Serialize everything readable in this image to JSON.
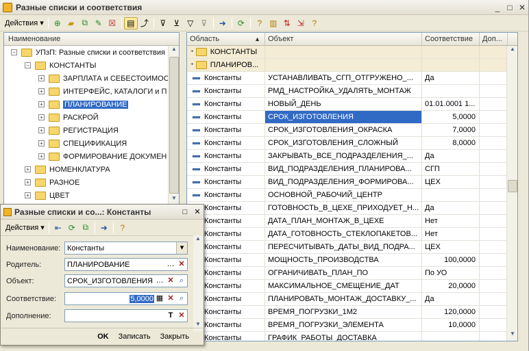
{
  "window": {
    "title": "Разные списки и соответствия",
    "controls": [
      "_",
      "□",
      "✕"
    ]
  },
  "toolbar": {
    "actions_label": "Действия"
  },
  "tree": {
    "header": "Наименование",
    "items": [
      {
        "label": "УПзП: Разные списки и соответствия",
        "level": 0,
        "expander": "−"
      },
      {
        "label": "КОНСТАНТЫ",
        "level": 1,
        "expander": "−"
      },
      {
        "label": "ЗАРПЛАТА и СЕБЕСТОИМОСТЬ",
        "level": 2,
        "expander": "+"
      },
      {
        "label": "ИНТЕРФЕЙС, КАТАЛОГИ и П",
        "level": 2,
        "expander": "+"
      },
      {
        "label": "ПЛАНИРОВАНИЕ",
        "level": 2,
        "expander": "+",
        "selected": true
      },
      {
        "label": "РАСКРОЙ",
        "level": 2,
        "expander": "+"
      },
      {
        "label": "РЕГИСТРАЦИЯ",
        "level": 2,
        "expander": "+"
      },
      {
        "label": "СПЕЦИФИКАЦИЯ",
        "level": 2,
        "expander": "+"
      },
      {
        "label": "ФОРМИРОВАНИЕ ДОКУМЕН",
        "level": 2,
        "expander": "+"
      },
      {
        "label": "НОМЕНКЛАТУРА",
        "level": 1,
        "expander": "+"
      },
      {
        "label": "РАЗНОЕ",
        "level": 1,
        "expander": "+"
      },
      {
        "label": "ЦВЕТ",
        "level": 1,
        "expander": "+"
      }
    ]
  },
  "grid": {
    "headers": [
      "Область",
      "Объект",
      "Соответствие",
      "Доп..."
    ],
    "rows": [
      {
        "area": "КОНСТАНТЫ",
        "object": "",
        "match": "",
        "kind": "folder"
      },
      {
        "area": "ПЛАНИРОВ...",
        "object": "",
        "match": "",
        "kind": "folder"
      },
      {
        "area": "Константы",
        "object": "УСТАНАВЛИВАТЬ_СГП_ОТГРУЖЕНО_...",
        "match": "Да"
      },
      {
        "area": "Константы",
        "object": "РМД_НАСТРОЙКА_УДАЛЯТЬ_МОНТАЖ",
        "match": ""
      },
      {
        "area": "Константы",
        "object": "НОВЫЙ_ДЕНЬ",
        "match": "01.01.0001 1..."
      },
      {
        "area": "Константы",
        "object": "СРОК_ИЗГОТОВЛЕНИЯ",
        "match": "5,0000",
        "numeric": true,
        "selected": true
      },
      {
        "area": "Константы",
        "object": "СРОК_ИЗГОТОВЛЕНИЯ_ОКРАСКА",
        "match": "7,0000",
        "numeric": true
      },
      {
        "area": "Константы",
        "object": "СРОК_ИЗГОТОВЛЕНИЯ_СЛОЖНЫЙ",
        "match": "8,0000",
        "numeric": true
      },
      {
        "area": "Константы",
        "object": "ЗАКРЫВАТЬ_ВСЕ_ПОДРАЗДЕЛЕНИЯ_...",
        "match": "Да"
      },
      {
        "area": "Константы",
        "object": "ВИД_ПОДРАЗДЕЛЕНИЯ_ПЛАНИРОВА...",
        "match": "СГП"
      },
      {
        "area": "Константы",
        "object": "ВИД_ПОДРАЗДЕЛЕНИЯ_ФОРМИРОВА...",
        "match": "ЦЕХ"
      },
      {
        "area": "Константы",
        "object": "ОСНОВНОЙ_РАБОЧИЙ_ЦЕНТР",
        "match": ""
      },
      {
        "area": "Константы",
        "object": "ГОТОВНОСТЬ_В_ЦЕХЕ_ПРИХОДУЕТ_Н...",
        "match": "Да"
      },
      {
        "area": "Константы",
        "object": "ДАТА_ПЛАН_МОНТАЖ_В_ЦЕХЕ",
        "match": "Нет"
      },
      {
        "area": "Константы",
        "object": "ДАТА_ГОТОВНОСТЬ_СТЕКЛОПАКЕТОВ...",
        "match": "Нет"
      },
      {
        "area": "Константы",
        "object": "ПЕРЕСЧИТЫВАТЬ_ДАТЫ_ВИД_ПОДРА...",
        "match": "ЦЕХ"
      },
      {
        "area": "Константы",
        "object": "МОЩНОСТЬ_ПРОИЗВОДСТВА",
        "match": "100,0000",
        "numeric": true
      },
      {
        "area": "Константы",
        "object": "ОГРАНИЧИВАТЬ_ПЛАН_ПО",
        "match": "По УО"
      },
      {
        "area": "Константы",
        "object": "МАКСИМАЛЬНОЕ_СМЕЩЕНИЕ_ДАТ",
        "match": "20,0000",
        "numeric": true
      },
      {
        "area": "Константы",
        "object": "ПЛАНИРОВАТЬ_МОНТАЖ_ДОСТАВКУ_...",
        "match": "Да"
      },
      {
        "area": "Константы",
        "object": "ВРЕМЯ_ПОГРУЗКИ_1М2",
        "match": "120,0000",
        "numeric": true
      },
      {
        "area": "Константы",
        "object": "ВРЕМЯ_ПОГРУЗКИ_ЭЛЕМЕНТА",
        "match": "10,0000",
        "numeric": true
      },
      {
        "area": "Константы",
        "object": "ГРАФИК_РАБОТЫ_ДОСТАВКА",
        "match": ""
      }
    ]
  },
  "dialog": {
    "title": "Разные списки и со...: Константы",
    "actions_label": "Действия",
    "fields": {
      "name_label": "Наименование:",
      "name_value": "Константы",
      "parent_label": "Родитель:",
      "parent_value": "ПЛАНИРОВАНИЕ",
      "object_label": "Объект:",
      "object_value": "СРОК_ИЗГОТОВЛЕНИЯ",
      "match_label": "Соответствие:",
      "match_value": "5,0000",
      "extra_label": "Дополнение:",
      "extra_value": ""
    },
    "buttons": {
      "ok": "OK",
      "save": "Записать",
      "close": "Закрыть"
    }
  }
}
